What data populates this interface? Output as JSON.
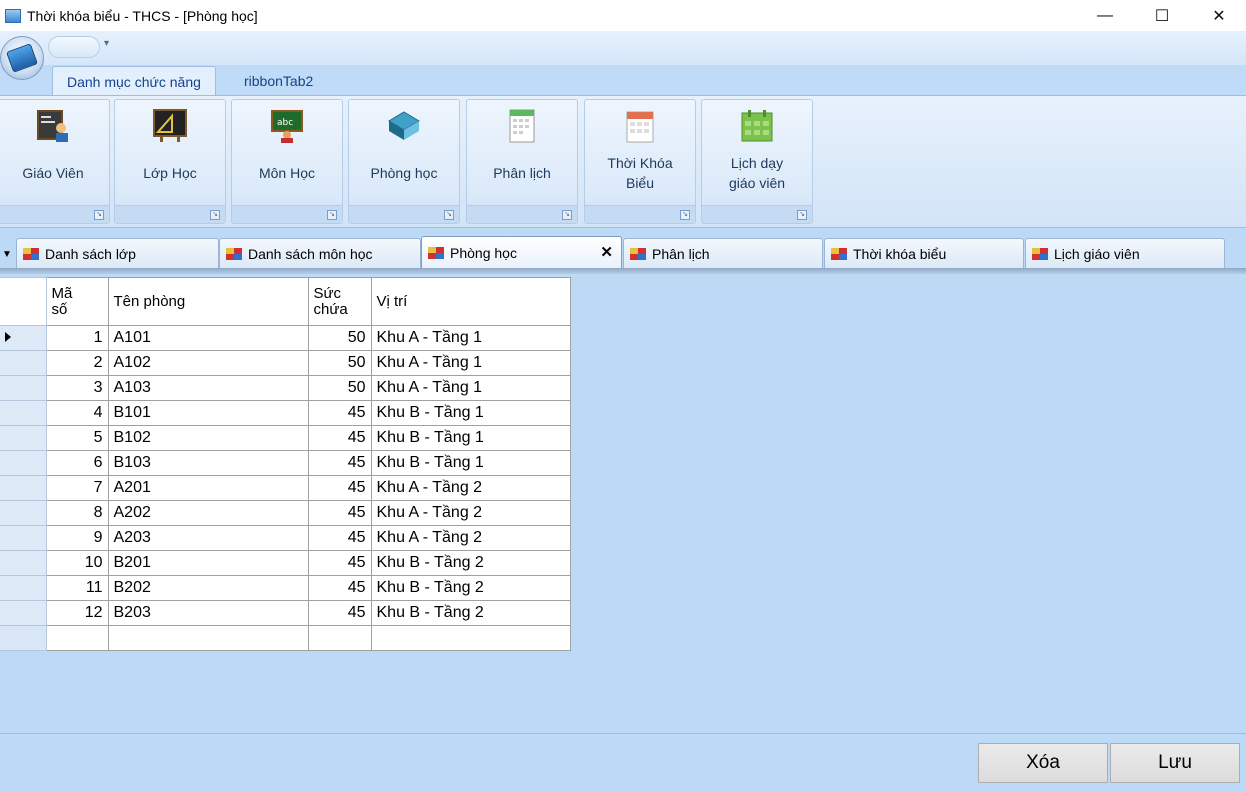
{
  "window": {
    "title": "Thời khóa biểu - THCS - [Phòng học]",
    "minimize_glyph": "—",
    "maximize_glyph": "☐",
    "close_glyph": "✕"
  },
  "ribbon": {
    "tabs": [
      {
        "label": "Danh mục chức năng",
        "active": true
      },
      {
        "label": "ribbonTab2",
        "active": false
      }
    ],
    "groups": [
      {
        "label": "Giáo Viên",
        "icon": "teacher-board-icon"
      },
      {
        "label": "Lớp Học",
        "icon": "classroom-board-icon"
      },
      {
        "label": "Môn Học",
        "icon": "subject-board-icon"
      },
      {
        "label": "Phòng học",
        "icon": "room-book-icon"
      },
      {
        "label": "Phân lịch",
        "icon": "schedule-document-icon"
      },
      {
        "label_line1": "Thời Khóa",
        "label_line2": "Biểu",
        "icon": "timetable-calendar-icon"
      },
      {
        "label_line1": "Lịch dạy",
        "label_line2": "giáo viên",
        "icon": "teacher-calendar-icon"
      }
    ]
  },
  "doc_tabs": [
    {
      "label": "Danh sách lớp",
      "active": false
    },
    {
      "label": "Danh sách môn học",
      "active": false
    },
    {
      "label": "Phòng học",
      "active": true
    },
    {
      "label": "Phân lịch",
      "active": false
    },
    {
      "label": "Thời khóa biểu",
      "active": false
    },
    {
      "label": "Lịch giáo viên",
      "active": false
    }
  ],
  "grid": {
    "headers": {
      "ma_so_line1": "Mã",
      "ma_so_line2": "số",
      "ten_phong": "Tên phòng",
      "suc_chua_line1": "Sức",
      "suc_chua_line2": "chứa",
      "vi_tri": "Vị trí"
    },
    "rows": [
      {
        "ma_so": "1",
        "ten_phong": "A101",
        "suc_chua": "50",
        "vi_tri": "Khu A - Tầng 1"
      },
      {
        "ma_so": "2",
        "ten_phong": "A102",
        "suc_chua": "50",
        "vi_tri": "Khu A - Tầng 1"
      },
      {
        "ma_so": "3",
        "ten_phong": "A103",
        "suc_chua": "50",
        "vi_tri": "Khu A - Tầng 1"
      },
      {
        "ma_so": "4",
        "ten_phong": "B101",
        "suc_chua": "45",
        "vi_tri": "Khu B - Tầng 1"
      },
      {
        "ma_so": "5",
        "ten_phong": "B102",
        "suc_chua": "45",
        "vi_tri": "Khu B - Tầng 1"
      },
      {
        "ma_so": "6",
        "ten_phong": "B103",
        "suc_chua": "45",
        "vi_tri": "Khu B - Tầng 1"
      },
      {
        "ma_so": "7",
        "ten_phong": "A201",
        "suc_chua": "45",
        "vi_tri": "Khu A - Tầng 2"
      },
      {
        "ma_so": "8",
        "ten_phong": "A202",
        "suc_chua": "45",
        "vi_tri": "Khu A - Tầng 2"
      },
      {
        "ma_so": "9",
        "ten_phong": "A203",
        "suc_chua": "45",
        "vi_tri": "Khu A - Tầng 2"
      },
      {
        "ma_so": "10",
        "ten_phong": "B201",
        "suc_chua": "45",
        "vi_tri": "Khu B - Tầng 2"
      },
      {
        "ma_so": "11",
        "ten_phong": "B202",
        "suc_chua": "45",
        "vi_tri": "Khu B - Tầng 2"
      },
      {
        "ma_so": "12",
        "ten_phong": "B203",
        "suc_chua": "45",
        "vi_tri": "Khu B - Tầng 2"
      }
    ]
  },
  "buttons": {
    "delete_label": "Xóa",
    "save_label": "Lưu"
  },
  "colors": {
    "background": "#bcd9f5",
    "ribbon_text": "#15428b"
  }
}
